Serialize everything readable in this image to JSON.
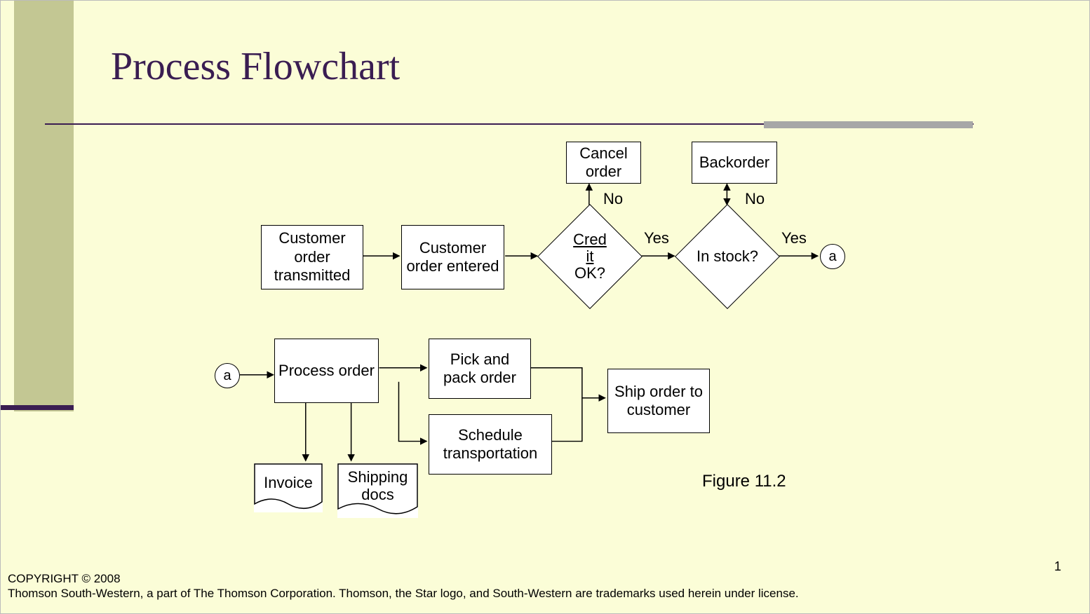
{
  "title": "Process Flowchart",
  "figure_label": "Figure 11.2",
  "page_number": "1",
  "footer_line1": "COPYRIGHT © 2008",
  "footer_line2": "Thomson South-Western, a part of The Thomson Corporation. Thomson, the Star logo, and South-Western are trademarks used herein under license.",
  "nodes": {
    "cust_transmitted": "Customer order transmitted",
    "cust_entered": "Customer order entered",
    "credit_ok_l1": "Cred",
    "credit_ok_l2": "it",
    "credit_ok_l3": "OK?",
    "in_stock": "In stock?",
    "cancel_order": "Cancel order",
    "backorder": "Backorder",
    "connector_a": "a",
    "process_order": "Process order",
    "pick_pack": "Pick and pack order",
    "schedule_trans": "Schedule transportation",
    "ship_order": "Ship order to customer",
    "invoice": "Invoice",
    "shipping_docs": "Shipping docs"
  },
  "labels": {
    "yes": "Yes",
    "no": "No"
  }
}
